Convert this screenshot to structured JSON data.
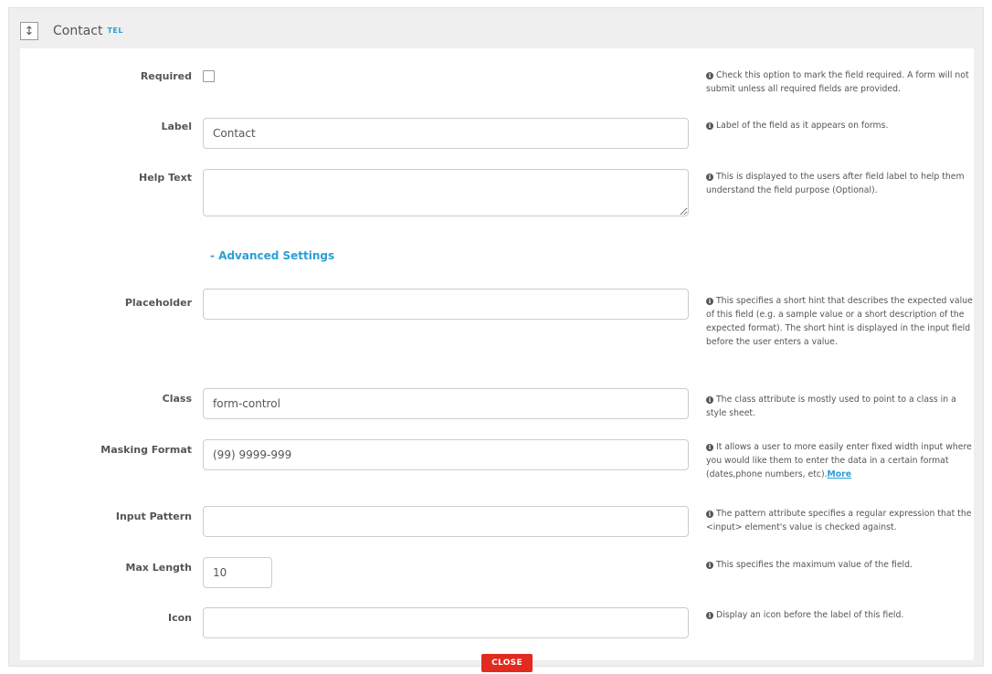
{
  "header": {
    "field_name": "Contact",
    "field_type": "TEL",
    "drag_glyph": "↕"
  },
  "fields": {
    "required": {
      "label": "Required",
      "help": "Check this option to mark the field required. A form will not submit unless all required fields are provided."
    },
    "label": {
      "label": "Label",
      "value": "Contact",
      "help": "Label of the field as it appears on forms."
    },
    "help_text": {
      "label": "Help Text",
      "value": "",
      "help": "This is displayed to the users after field label to help them understand the field purpose (Optional)."
    },
    "advanced": "- Advanced Settings",
    "placeholder": {
      "label": "Placeholder",
      "value": "",
      "help": "This specifies a short hint that describes the expected value of this field (e.g. a sample value or a short description of the expected format). The short hint is displayed in the input field before the user enters a value."
    },
    "class": {
      "label": "Class",
      "value": "form-control",
      "help": "The class attribute is mostly used to point to a class in a style sheet."
    },
    "masking_format": {
      "label": "Masking Format",
      "value": "(99) 9999-999",
      "help": "It allows a user to more easily enter fixed width input where you would like them to enter the data in a certain format (dates,phone numbers, etc).",
      "more": "More"
    },
    "input_pattern": {
      "label": "Input Pattern",
      "value": "",
      "help": "The pattern attribute specifies a regular expression that the <input> element's value is checked against."
    },
    "max_length": {
      "label": "Max Length",
      "value": "10",
      "help": "This specifies the maximum value of the field."
    },
    "icon": {
      "label": "Icon",
      "value": "",
      "help": "Display an icon before the label of this field."
    }
  },
  "info_glyph": "i",
  "close_label": "CLOSE",
  "colors": {
    "accent": "#2a9fd6",
    "close": "#e22a1f",
    "panel": "#efefef"
  }
}
